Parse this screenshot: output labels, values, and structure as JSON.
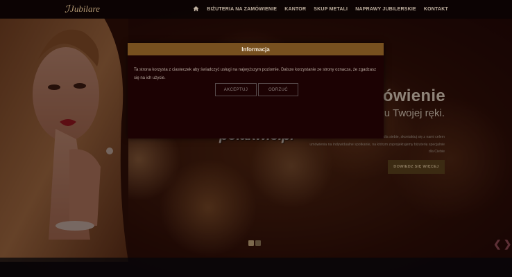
{
  "site": {
    "logo_text": "Jubilare",
    "watermark": "polakwie.pl"
  },
  "nav": {
    "home_icon": "home-icon",
    "items": [
      {
        "label": "BIŻUTERIA NA ZAMÓWIENIE"
      },
      {
        "label": "KANTOR"
      },
      {
        "label": "SKUP METALI"
      },
      {
        "label": "NAPRAWY JUBILERSKIE"
      },
      {
        "label": "KONTAKT"
      }
    ]
  },
  "hero": {
    "headline": "ówienie",
    "subline": "ju Twojej ręki.",
    "body": "Jeśli nie znalazłeś/-aś czegoś zrobionego dla siebie, skontaktuj się z nami celem umówienia na indywidualne spotkanie, na którym zaprojektujemy biżuterię specjalnie dla Ciebie",
    "button_label": "DOWIEDZ SIĘ WIĘCEJ",
    "slider_dots": 2,
    "active_dot": 0,
    "prev_icon": "chevron-left-icon",
    "next_icon": "chevron-right-icon"
  },
  "modal": {
    "title": "Informacja",
    "text": "Ta strona korzysta z ciasteczek aby świadczyć usługi na najwyższym poziomie. Dalsze korzystanie ze strony oznacza, że zgadzasz się na ich użycie.",
    "accept_label": "AKCEPTUJ",
    "reject_label": "ODRZUĆ"
  },
  "colors": {
    "accent": "#77501f",
    "modal_bg": "#1c0203",
    "background": "#140807"
  }
}
